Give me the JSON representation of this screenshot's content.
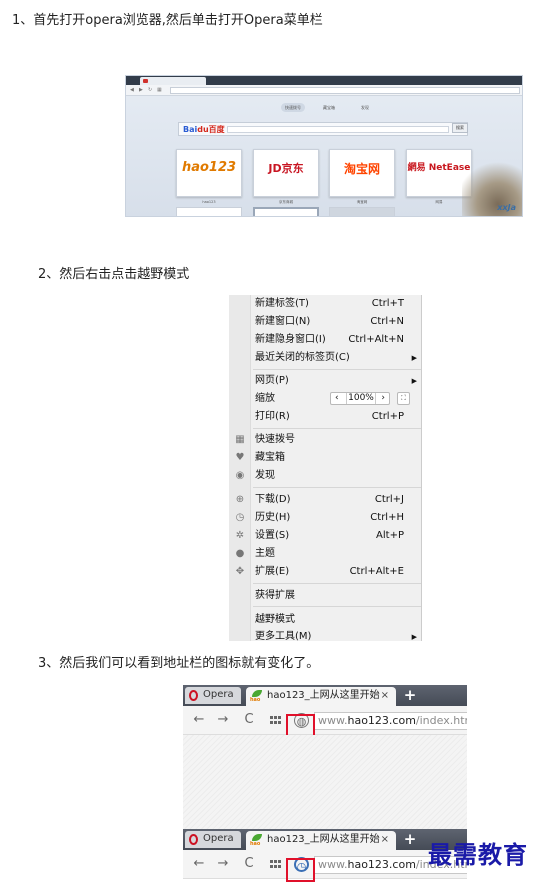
{
  "steps": {
    "s1": "1、首先打开opera浏览器,然后单击打开Opera菜单栏",
    "s2": "2、然后右击点击越野模式",
    "s3": "3、然后我们可以看到地址栏的图标就有变化了。"
  },
  "fig1": {
    "baidu_logo": "Bai",
    "baidu_logo_accent": "du百度",
    "search_button": "搜索",
    "pills": [
      "快速拨号",
      "藏宝箱",
      "发现"
    ],
    "dials": [
      {
        "logo": "hao123",
        "color": "#e07a00",
        "caption": "hao123"
      },
      {
        "logo": "JD京东",
        "color": "#c81623",
        "caption": "京东商城"
      },
      {
        "logo": "淘宝网",
        "color": "#ff4400",
        "caption": "淘宝网"
      },
      {
        "logo": "網易 NetEase",
        "color": "#c8161d",
        "caption": "网易"
      }
    ],
    "watermark": "xxJa"
  },
  "menu": {
    "items": [
      {
        "label": "新建标签(T)",
        "shortcut": "Ctrl+T",
        "icon": ""
      },
      {
        "label": "新建窗口(N)",
        "shortcut": "Ctrl+N",
        "icon": ""
      },
      {
        "label": "新建隐身窗口(I)",
        "shortcut": "Ctrl+Alt+N",
        "icon": ""
      },
      {
        "label": "最近关闭的标签页(C)",
        "shortcut": "",
        "icon": "",
        "submenu": true
      },
      {
        "label": "网页(P)",
        "shortcut": "",
        "icon": "",
        "submenu": true
      },
      {
        "label": "缩放",
        "shortcut": "",
        "icon": ""
      },
      {
        "label": "打印(R)",
        "shortcut": "Ctrl+P",
        "icon": ""
      },
      {
        "label": "快速拨号",
        "shortcut": "",
        "icon": "speed-dial-icon"
      },
      {
        "label": "藏宝箱",
        "shortcut": "",
        "icon": "heart-icon"
      },
      {
        "label": "发现",
        "shortcut": "",
        "icon": "eye-icon"
      },
      {
        "label": "下载(D)",
        "shortcut": "Ctrl+J",
        "icon": "download-icon"
      },
      {
        "label": "历史(H)",
        "shortcut": "Ctrl+H",
        "icon": "clock-icon"
      },
      {
        "label": "设置(S)",
        "shortcut": "Alt+P",
        "icon": "gear-icon"
      },
      {
        "label": "主题",
        "shortcut": "",
        "icon": "drop-icon"
      },
      {
        "label": "扩展(E)",
        "shortcut": "Ctrl+Alt+E",
        "icon": "puzzle-icon"
      },
      {
        "label": "获得扩展",
        "shortcut": "",
        "icon": ""
      },
      {
        "label": "越野模式",
        "shortcut": "",
        "icon": ""
      },
      {
        "label": "更多工具(M)",
        "shortcut": "",
        "icon": "",
        "submenu": true
      }
    ],
    "zoom_value": "100%"
  },
  "fig3": {
    "opera_tab": "Opera",
    "page_tab": "hao123_上网从这里开始",
    "close_glyph": "×",
    "new_tab_glyph": "+",
    "url_prefix": "www.",
    "url_domain": "hao123.com",
    "url_path": "/index.html"
  },
  "watermark": "最需教育",
  "colors": {
    "highlight": "#e0102a",
    "watermark": "#1a1aa8"
  }
}
